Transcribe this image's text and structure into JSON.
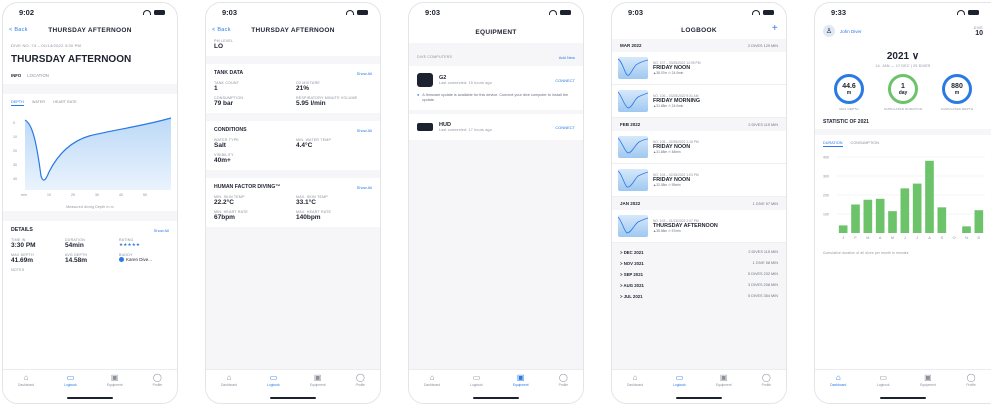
{
  "screens": {
    "dive": {
      "time": "9:02",
      "back": "< Back",
      "nav_title": "THURSDAY AFTERNOON",
      "dive_no": "DIVE NO. 74 – 01/14/2022 3:30 PM",
      "title": "THURSDAY AFTERNOON",
      "tabs": [
        "INFO",
        "LOCATION"
      ],
      "chart_tabs": [
        "DEPTH",
        "WATER",
        "HEART RATE"
      ],
      "chart_caption": "Measured diving Depth in m",
      "details_title": "DETAILS",
      "details_link": "Show All",
      "details": [
        {
          "label": "TIME IN",
          "value": "3:30 PM"
        },
        {
          "label": "DURATION",
          "value": "54min"
        },
        {
          "label": "RATING",
          "value": "★★★★★"
        },
        {
          "label": "MAX DEPTH",
          "value": "41.69m"
        },
        {
          "label": "AVG DEPTH",
          "value": "14.58m"
        },
        {
          "label": "BUDDY",
          "value": "Karen Dive..."
        }
      ],
      "notes_label": "NOTES"
    },
    "tanks": {
      "time": "9:03",
      "back": "< Back",
      "nav_title": "THURSDAY AFTERNOON",
      "top_label": "PM LEVEL",
      "top_value": "LO",
      "tank": {
        "title": "TANK DATA",
        "link": "Show All",
        "items": [
          {
            "label": "TANK COUNT",
            "value": "1"
          },
          {
            "label": "O2 MIXTURE",
            "value": "21%"
          },
          {
            "label": "CONSUMPTION",
            "value": "79 bar"
          },
          {
            "label": "RESPIRATORY MINUTE VOLUME",
            "value": "5.95 l/min"
          }
        ]
      },
      "conditions": {
        "title": "CONDITIONS",
        "link": "Show All",
        "items": [
          {
            "label": "WATER TYPE",
            "value": "Salt"
          },
          {
            "label": "MIN. WATER TEMP",
            "value": "4.4°C"
          },
          {
            "label": "VISIBILITY",
            "value": "40m+"
          }
        ]
      },
      "hf": {
        "title": "HUMAN FACTOR DIVING™",
        "link": "Show All",
        "items": [
          {
            "label": "MIN. SKIN TEMP",
            "value": "22.2°C"
          },
          {
            "label": "MAX. SKIN TEMP",
            "value": "33.1°C"
          },
          {
            "label": "MIN. HEART RATE",
            "value": "67bpm"
          },
          {
            "label": "MAX. HEART RATE",
            "value": "140bpm"
          }
        ]
      }
    },
    "equipment": {
      "time": "9:03",
      "nav_title": "EQUIPMENT",
      "section": "DIVE COMPUTERS",
      "add": "Add New",
      "devices": [
        {
          "name": "G2",
          "last": "Last connected: 15 hours ago",
          "action": "CONNECT"
        },
        {
          "name": "HUD",
          "last": "Last connected: 17 hours ago",
          "action": "CONNECT"
        }
      ],
      "notice": "A firmware update is available for this device. Connect your dive computer to install the update."
    },
    "logbook": {
      "time": "9:03",
      "nav_title": "LOGBOOK",
      "groups": [
        {
          "month": "MAR 2022",
          "summary": "2 DIVES   129 MIN",
          "items": [
            {
              "meta": "NO. 107 – 03/25/2022 12:09 PM",
              "name": "FRIDAY NOON",
              "foot": "▲38.07m  ⏱ 24.0min"
            },
            {
              "meta": "NO. 106 – 03/25/2022 9:31 AM",
              "name": "FRIDAY MORNING",
              "foot": "▲31.68m  ⏱ 24.0min"
            }
          ]
        },
        {
          "month": "FEB 2022",
          "summary": "2 DIVES   115 MIN",
          "items": [
            {
              "meta": "NO. 105 – 02/25/2022 1:18 PM",
              "name": "FRIDAY NOON",
              "foot": "▲31.68m  ⏱ 48min"
            },
            {
              "meta": "NO. 104 – 02/18/2022 1:03 PM",
              "name": "FRIDAY NOON",
              "foot": "▲32.08m  ⏱ 59min"
            }
          ]
        },
        {
          "month": "JAN 2022",
          "summary": "1 DIVE   57 MIN",
          "items": [
            {
              "meta": "NO. 103 – 01/13/2022 2:07 PM",
              "name": "THURSDAY AFTERNOON",
              "foot": "▲35.58m  ⏱ 57min"
            }
          ]
        }
      ],
      "collapsed": [
        {
          "month": "> DEC 2021",
          "summary": "2 DIVES   115 MIN"
        },
        {
          "month": "> NOV 2021",
          "summary": "1 DIVE   58 MIN"
        },
        {
          "month": "> SEP 2021",
          "summary": "5 DIVES   232 MIN"
        },
        {
          "month": "> AUG 2021",
          "summary": "3 DIVES   208 MIN"
        },
        {
          "month": "> JUL 2021",
          "summary": "5 DIVES   354 MIN"
        }
      ]
    },
    "dashboard": {
      "time": "9:33",
      "user": "John Diver",
      "dives_label": "DIVE",
      "dives_value": "10",
      "year": "2021 ∨",
      "range": "14. JAN — 17 DEC | 25 DIVES",
      "rings": [
        {
          "value": "44.6",
          "unit": "m",
          "label": "MAX DEPTH",
          "color": "#2a79e4"
        },
        {
          "value": "1",
          "unit": "day",
          "label": "CUMULATED DURATION",
          "color": "#6cc36a"
        },
        {
          "value": "880",
          "unit": "m",
          "label": "CUMULATED DEPTH",
          "color": "#2a79e4"
        }
      ],
      "stat_title": "STATISTIC OF 2021",
      "stat_tabs": [
        "DURATION",
        "CONSUMPTION"
      ],
      "caption": "Cumulative duration of all dives per month in minutes",
      "chart_data": {
        "type": "bar",
        "categories": [
          "J",
          "F",
          "M",
          "A",
          "M",
          "J",
          "J",
          "A",
          "S",
          "O",
          "N",
          "D"
        ],
        "values": [
          40,
          150,
          175,
          180,
          115,
          235,
          260,
          380,
          135,
          0,
          35,
          120
        ],
        "ylim": [
          0,
          400
        ],
        "yticks": [
          "400",
          "300",
          "200",
          "100"
        ],
        "color": "#6cc36a"
      }
    },
    "tabbar": {
      "items": [
        "Dashboard",
        "Logbook",
        "Equipment",
        "Profile"
      ]
    }
  }
}
